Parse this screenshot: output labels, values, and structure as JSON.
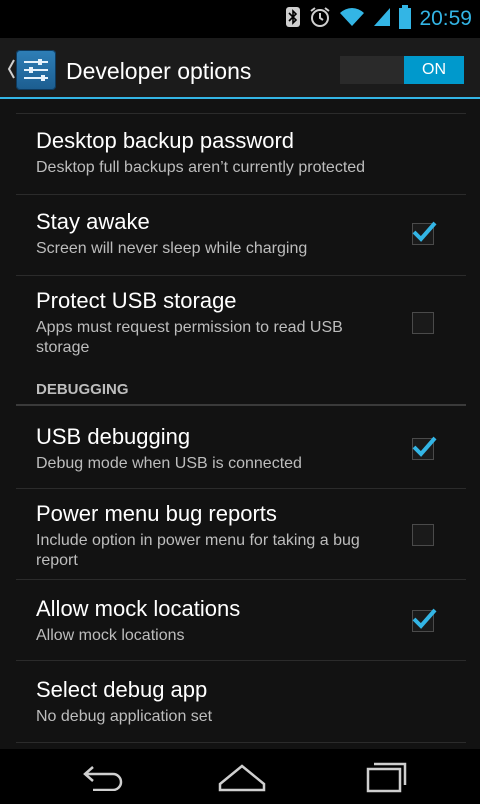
{
  "status_bar": {
    "time": "20:59",
    "icons": [
      "bluetooth-icon",
      "alarm-icon",
      "wifi-icon",
      "signal-icon",
      "battery-icon"
    ],
    "accent_color": "#33b5e5"
  },
  "action_bar": {
    "title": "Developer options",
    "switch_label": "ON",
    "switch_color": "#0099cc",
    "app_icon": "settings-sliders-icon",
    "up_icon": "chevron-left-icon"
  },
  "preferences": [
    {
      "title": "Desktop backup password",
      "summary": "Desktop full backups aren’t currently protected",
      "checkbox": null
    },
    {
      "title": "Stay awake",
      "summary": "Screen will never sleep while charging",
      "checkbox": true
    },
    {
      "title": "Protect USB storage",
      "summary": "Apps must request permission to read USB storage",
      "checkbox": false
    }
  ],
  "section_debugging": "DEBUGGING",
  "debug_preferences": [
    {
      "title": "USB debugging",
      "summary": "Debug mode when USB is connected",
      "checkbox": true
    },
    {
      "title": "Power menu bug reports",
      "summary": "Include option in power menu for taking a bug report",
      "checkbox": false
    },
    {
      "title": "Allow mock locations",
      "summary": "Allow mock locations",
      "checkbox": true
    },
    {
      "title": "Select debug app",
      "summary": "No debug application set",
      "checkbox": null
    }
  ],
  "nav_bar": {
    "buttons": [
      "back-icon",
      "home-icon",
      "recents-icon"
    ]
  }
}
